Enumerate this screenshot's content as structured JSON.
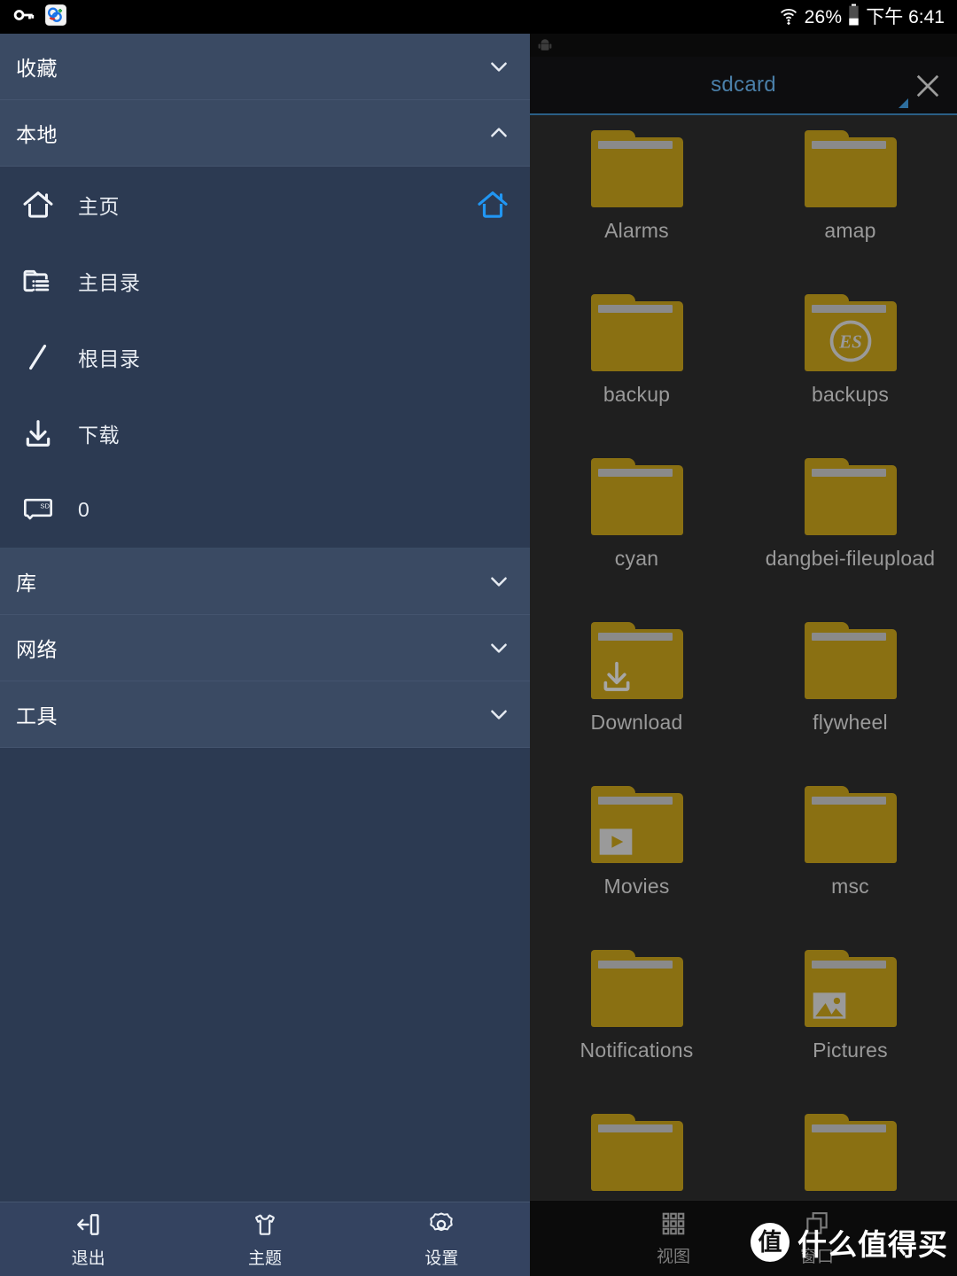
{
  "status_bar": {
    "left_icons": [
      "vpn-key-icon",
      "app-sync-icon"
    ],
    "wifi_icon": "wifi-icon",
    "battery_text": "26%",
    "battery_icon": "battery-icon",
    "time": "下午 6:41"
  },
  "sidebar": {
    "groups": [
      {
        "label": "收藏",
        "expanded": false,
        "chevron": "chevron-down-icon"
      },
      {
        "label": "本地",
        "expanded": true,
        "chevron": "chevron-up-icon"
      }
    ],
    "local_items": [
      {
        "label": "主页",
        "icon": "home-icon",
        "right_icon": "home-accent-icon"
      },
      {
        "label": "主目录",
        "icon": "folder-list-icon",
        "right_icon": ""
      },
      {
        "label": "根目录",
        "icon": "slash-icon",
        "right_icon": ""
      },
      {
        "label": "下载",
        "icon": "download-icon",
        "right_icon": ""
      },
      {
        "label": "0",
        "icon": "sd-card-icon",
        "right_icon": ""
      }
    ],
    "bottom_groups": [
      {
        "label": "库",
        "chevron": "chevron-down-icon"
      },
      {
        "label": "网络",
        "chevron": "chevron-down-icon"
      },
      {
        "label": "工具",
        "chevron": "chevron-down-icon"
      }
    ],
    "bottom_bar": [
      {
        "label": "退出",
        "icon": "exit-icon"
      },
      {
        "label": "主题",
        "icon": "tshirt-icon"
      },
      {
        "label": "设置",
        "icon": "gear-icon"
      }
    ]
  },
  "file_panel": {
    "tab": {
      "title": "sdcard",
      "close_icon": "close-icon",
      "indicator": "triangle-icon"
    },
    "folders": [
      {
        "name": "Alarms",
        "overlay": ""
      },
      {
        "name": "amap",
        "overlay": ""
      },
      {
        "name": "backup",
        "overlay": ""
      },
      {
        "name": "backups",
        "overlay": "es-logo-icon"
      },
      {
        "name": "cyan",
        "overlay": ""
      },
      {
        "name": "dangbei-fileupload",
        "overlay": ""
      },
      {
        "name": "Download",
        "overlay": "download-icon"
      },
      {
        "name": "flywheel",
        "overlay": ""
      },
      {
        "name": "Movies",
        "overlay": "play-icon"
      },
      {
        "name": "msc",
        "overlay": ""
      },
      {
        "name": "Notifications",
        "overlay": ""
      },
      {
        "name": "Pictures",
        "overlay": "image-icon"
      },
      {
        "name": "",
        "overlay": ""
      },
      {
        "name": "",
        "overlay": ""
      }
    ],
    "bottom_bar": [
      {
        "label": "视图",
        "icon": "grid-view-icon"
      },
      {
        "label": "窗口",
        "icon": "windows-icon"
      }
    ]
  },
  "watermark": {
    "logo_text": "值",
    "text": "什么值得买"
  },
  "colors": {
    "sidebar_bg": "#2c3a52",
    "sidebar_header_bg": "#3a4a63",
    "sidebar_bottom_bg": "#344360",
    "panel_bg": "#1f1f1f",
    "folder": "#8a7012",
    "accent_blue": "#4a7fa8",
    "home_accent": "#2196f3",
    "folder_label": "#9a9a9a"
  }
}
